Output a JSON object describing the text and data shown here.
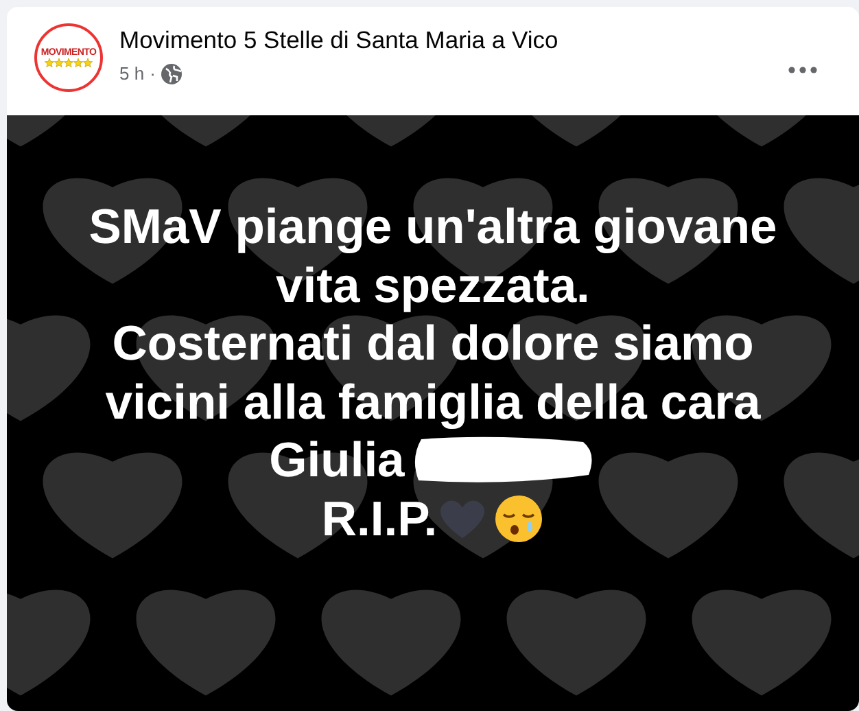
{
  "post": {
    "author": "Movimento 5 Stelle di Santa Maria a Vico",
    "logo_text": "MOVIMENTO",
    "time": "5 h",
    "separator": "·",
    "image": {
      "lines": [
        "SMaV piange un'altra giovane",
        "vita spezzata.",
        "Costernati dal dolore siamo",
        "vicini alla famiglia della cara",
        "Giulia",
        "R.I.P."
      ],
      "redacted": true
    }
  }
}
